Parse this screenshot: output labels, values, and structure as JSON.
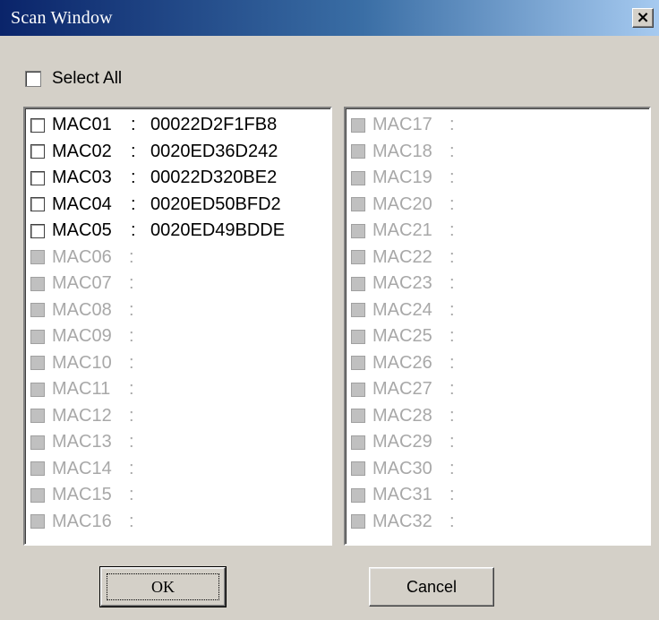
{
  "window": {
    "title": "Scan Window",
    "close_label": "×"
  },
  "select_all": {
    "label": "Select All",
    "checked": false
  },
  "list_left": [
    {
      "name": "MAC01",
      "sep": ":",
      "value": "00022D2F1FB8",
      "enabled": true
    },
    {
      "name": "MAC02",
      "sep": ":",
      "value": "0020ED36D242",
      "enabled": true
    },
    {
      "name": "MAC03",
      "sep": ":",
      "value": "00022D320BE2",
      "enabled": true
    },
    {
      "name": "MAC04",
      "sep": ":",
      "value": "0020ED50BFD2",
      "enabled": true
    },
    {
      "name": "MAC05",
      "sep": ":",
      "value": "0020ED49BDDE",
      "enabled": true
    },
    {
      "name": "MAC06",
      "sep": ":",
      "value": "",
      "enabled": false
    },
    {
      "name": "MAC07",
      "sep": ":",
      "value": "",
      "enabled": false
    },
    {
      "name": "MAC08",
      "sep": ":",
      "value": "",
      "enabled": false
    },
    {
      "name": "MAC09",
      "sep": ":",
      "value": "",
      "enabled": false
    },
    {
      "name": "MAC10",
      "sep": ":",
      "value": "",
      "enabled": false
    },
    {
      "name": "MAC11",
      "sep": ":",
      "value": "",
      "enabled": false
    },
    {
      "name": "MAC12",
      "sep": ":",
      "value": "",
      "enabled": false
    },
    {
      "name": "MAC13",
      "sep": ":",
      "value": "",
      "enabled": false
    },
    {
      "name": "MAC14",
      "sep": ":",
      "value": "",
      "enabled": false
    },
    {
      "name": "MAC15",
      "sep": ":",
      "value": "",
      "enabled": false
    },
    {
      "name": "MAC16",
      "sep": ":",
      "value": "",
      "enabled": false
    }
  ],
  "list_right": [
    {
      "name": "MAC17",
      "sep": ":",
      "value": "",
      "enabled": false
    },
    {
      "name": "MAC18",
      "sep": ":",
      "value": "",
      "enabled": false
    },
    {
      "name": "MAC19",
      "sep": ":",
      "value": "",
      "enabled": false
    },
    {
      "name": "MAC20",
      "sep": ":",
      "value": "",
      "enabled": false
    },
    {
      "name": "MAC21",
      "sep": ":",
      "value": "",
      "enabled": false
    },
    {
      "name": "MAC22",
      "sep": ":",
      "value": "",
      "enabled": false
    },
    {
      "name": "MAC23",
      "sep": ":",
      "value": "",
      "enabled": false
    },
    {
      "name": "MAC24",
      "sep": ":",
      "value": "",
      "enabled": false
    },
    {
      "name": "MAC25",
      "sep": ":",
      "value": "",
      "enabled": false
    },
    {
      "name": "MAC26",
      "sep": ":",
      "value": "",
      "enabled": false
    },
    {
      "name": "MAC27",
      "sep": ":",
      "value": "",
      "enabled": false
    },
    {
      "name": "MAC28",
      "sep": ":",
      "value": "",
      "enabled": false
    },
    {
      "name": "MAC29",
      "sep": ":",
      "value": "",
      "enabled": false
    },
    {
      "name": "MAC30",
      "sep": ":",
      "value": "",
      "enabled": false
    },
    {
      "name": "MAC31",
      "sep": ":",
      "value": "",
      "enabled": false
    },
    {
      "name": "MAC32",
      "sep": ":",
      "value": "",
      "enabled": false
    }
  ],
  "buttons": {
    "ok_label": "OK",
    "cancel_label": "Cancel"
  },
  "colors": {
    "titlebar_start": "#0a246a",
    "titlebar_end": "#a6caf0",
    "dialog_face": "#d4d0c8",
    "disabled_text": "#a8a8a8"
  }
}
